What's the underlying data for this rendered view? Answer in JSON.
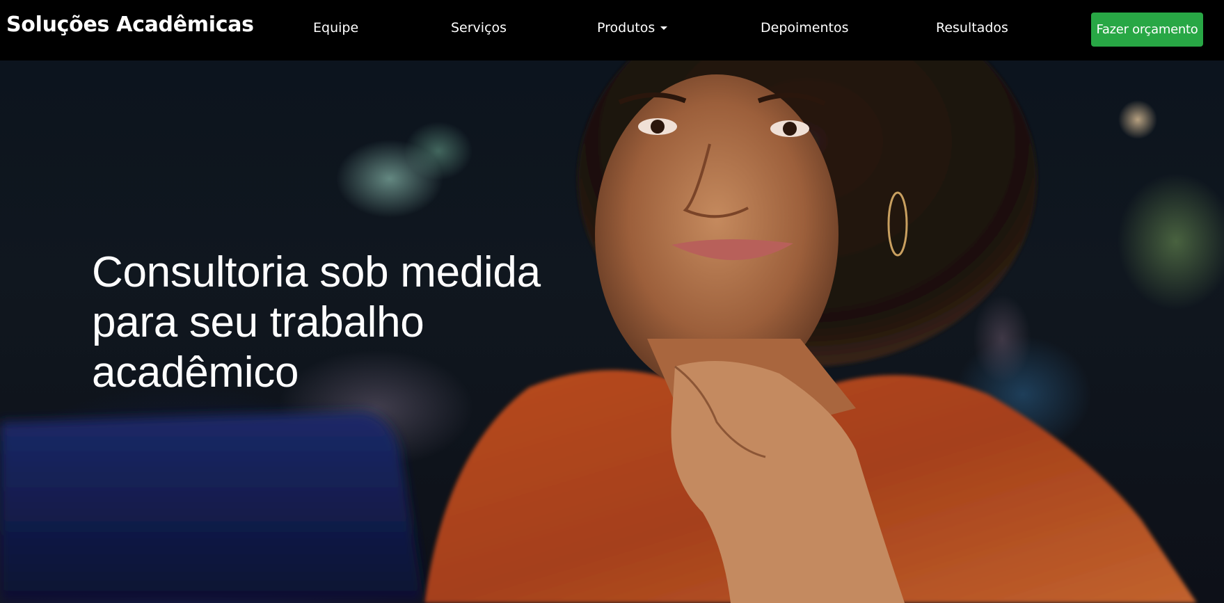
{
  "navbar": {
    "brand": "Soluções Acadêmicas",
    "links": [
      {
        "label": "Equipe"
      },
      {
        "label": "Serviços"
      },
      {
        "label": "Produtos",
        "has_dropdown": true
      },
      {
        "label": "Depoimentos"
      },
      {
        "label": "Resultados"
      }
    ],
    "cta_label": "Fazer orçamento"
  },
  "hero": {
    "headline": "Consultoria sob medida para seu trabalho acadêmico",
    "image_icon": "woman-portrait-photo"
  },
  "colors": {
    "navbar_bg": "#000000",
    "cta_bg": "#28a745",
    "text": "#ffffff"
  }
}
